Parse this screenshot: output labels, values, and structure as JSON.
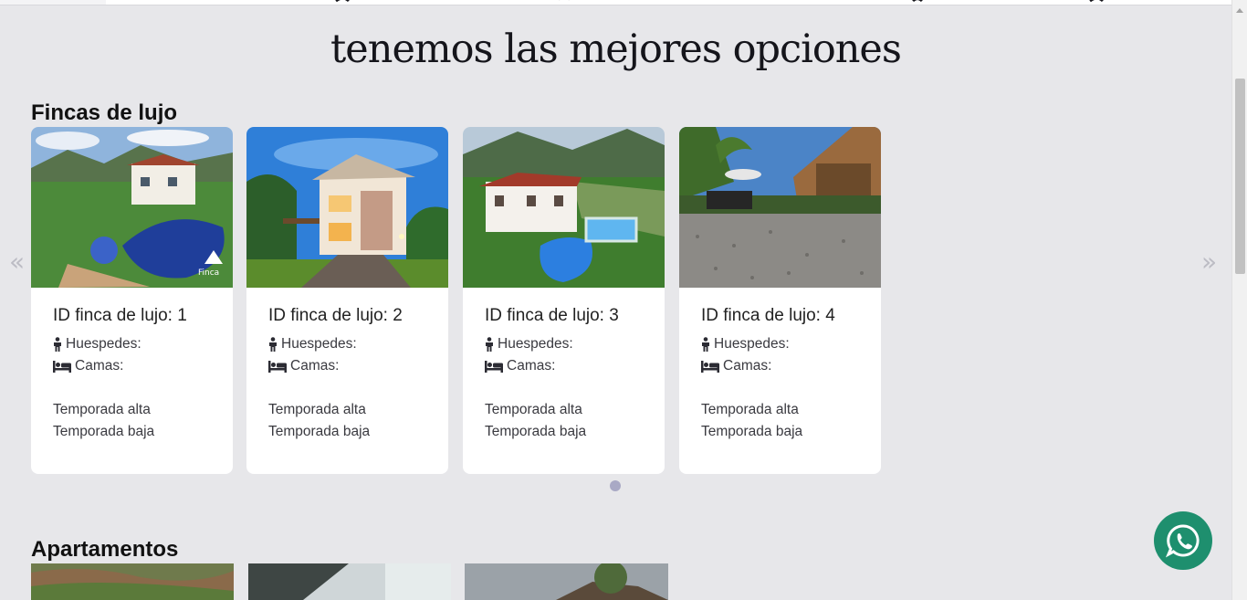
{
  "hero": {
    "line1": "tenemos las mejores opciones"
  },
  "sections": {
    "luxury": {
      "title": "Fincas de lujo"
    },
    "apartments": {
      "title": "Apartamentos"
    }
  },
  "carousel": {
    "prev": "«",
    "next": "»",
    "cards": [
      {
        "title": "ID finca de lujo: 1",
        "guests": "Huespedes:",
        "beds": "Camas:",
        "high": "Temporada alta",
        "low": "Temporada baja"
      },
      {
        "title": "ID finca de lujo: 2",
        "guests": "Huespedes:",
        "beds": "Camas:",
        "high": "Temporada alta",
        "low": "Temporada baja"
      },
      {
        "title": "ID finca de lujo: 3",
        "guests": "Huespedes:",
        "beds": "Camas:",
        "high": "Temporada alta",
        "low": "Temporada baja"
      },
      {
        "title": "ID finca de lujo: 4",
        "guests": "Huespedes:",
        "beds": "Camas:",
        "high": "Temporada alta",
        "low": "Temporada baja"
      }
    ]
  },
  "colors": {
    "background": "#e7e7ea",
    "card": "#ffffff",
    "whatsapp": "#1e8f6e",
    "dot": "#a9a9c5"
  },
  "icons": {
    "guests": "person-icon",
    "beds": "bed-icon",
    "chat": "whatsapp-icon"
  }
}
